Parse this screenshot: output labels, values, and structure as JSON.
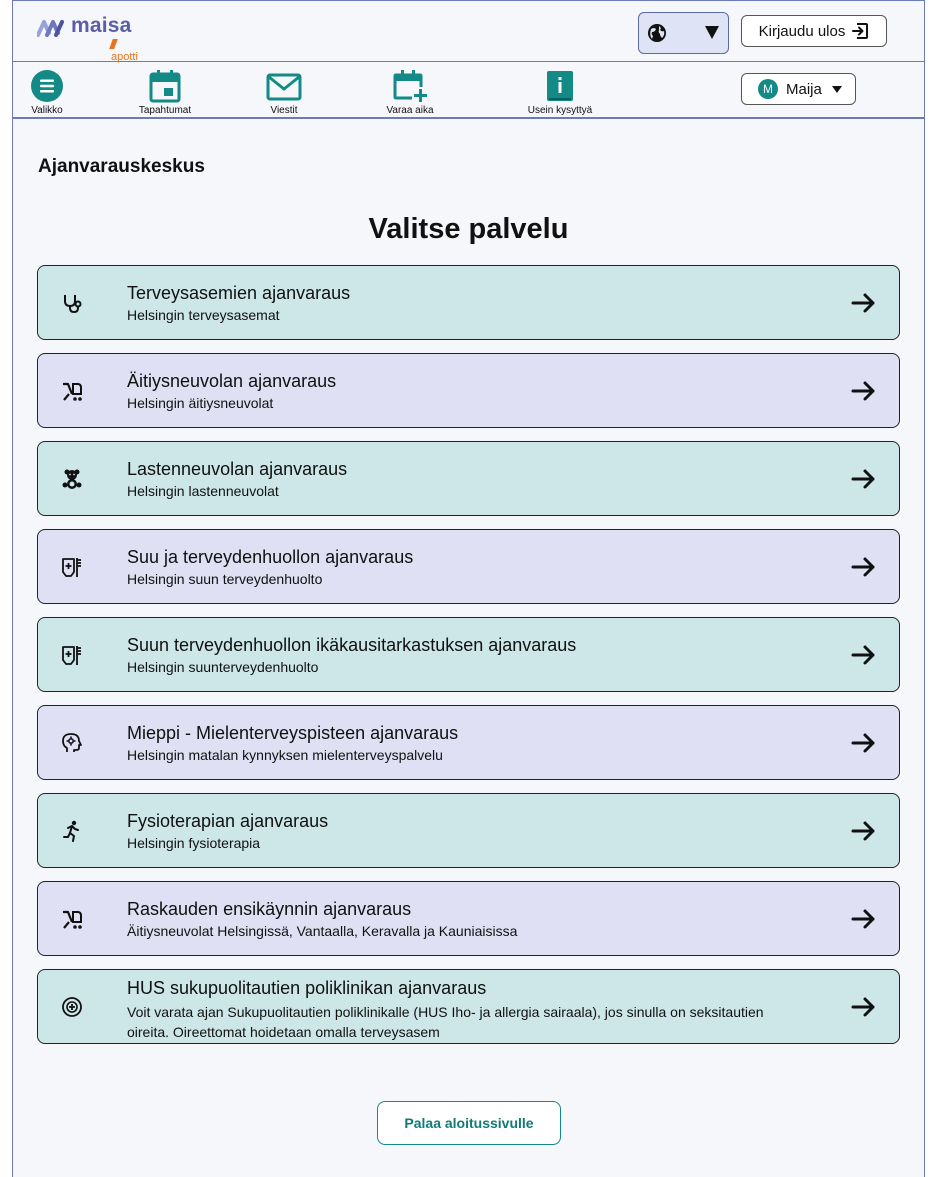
{
  "brand": {
    "name": "maisa",
    "sub": "apotti"
  },
  "header": {
    "logout_label": "Kirjaudu ulos"
  },
  "nav": {
    "items": [
      {
        "label": "Valikko",
        "icon": "menu-icon"
      },
      {
        "label": "Tapahtumat",
        "icon": "calendar-icon"
      },
      {
        "label": "Viestit",
        "icon": "mail-icon"
      },
      {
        "label": "Varaa aika",
        "icon": "calendar-plus-icon"
      },
      {
        "label": "Usein kysyttyä",
        "icon": "info-icon"
      }
    ],
    "user": {
      "initial": "M",
      "name": "Maija"
    }
  },
  "page": {
    "section_title": "Ajanvarauskeskus",
    "title": "Valitse palvelu",
    "back_label": "Palaa aloitussivulle"
  },
  "services": [
    {
      "title": "Terveysasemien ajanvaraus",
      "subtitle": "Helsingin terveysasemat",
      "icon": "stethoscope-icon"
    },
    {
      "title": "Äitiysneuvolan ajanvaraus",
      "subtitle": "Helsingin äitiysneuvolat",
      "icon": "stroller-icon"
    },
    {
      "title": "Lastenneuvolan ajanvaraus",
      "subtitle": "Helsingin lastenneuvolat",
      "icon": "teddy-bear-icon"
    },
    {
      "title": "Suu ja terveydenhuollon ajanvaraus",
      "subtitle": "Helsingin suun terveydenhuolto",
      "icon": "toothpaste-icon"
    },
    {
      "title": "Suun terveydenhuollon ikäkausitarkastuksen ajanvaraus",
      "subtitle": "Helsingin suunterveydenhuolto",
      "icon": "toothpaste-icon"
    },
    {
      "title": "Mieppi - Mielenterveyspisteen ajanvaraus",
      "subtitle": "Helsingin matalan kynnyksen mielenterveyspalvelu",
      "icon": "head-gear-icon"
    },
    {
      "title": "Fysioterapian ajanvaraus",
      "subtitle": "Helsingin fysioterapia",
      "icon": "running-person-icon"
    },
    {
      "title": "Raskauden ensikäynnin ajanvaraus",
      "subtitle": "Äitiysneuvolat Helsingissä, Vantaalla, Keravalla ja Kauniaisissa",
      "icon": "stroller-icon"
    },
    {
      "title": "HUS sukupuolitautien poliklinikan ajanvaraus",
      "subtitle": "Voit varata ajan Sukupuolitautien poliklinikalle (HUS Iho- ja allergia sairaala), jos sinulla on seksitautien oireita. Oireettomat hoidetaan omalla terveysasem",
      "icon": "medical-plus-icon"
    }
  ],
  "colors": {
    "accent": "#138a86",
    "card_teal": "#cde6e8",
    "card_lavender": "#dfe0f4",
    "border": "#6c7ab8",
    "brand": "#5b5ea6",
    "brand_sub": "#e8731c"
  }
}
